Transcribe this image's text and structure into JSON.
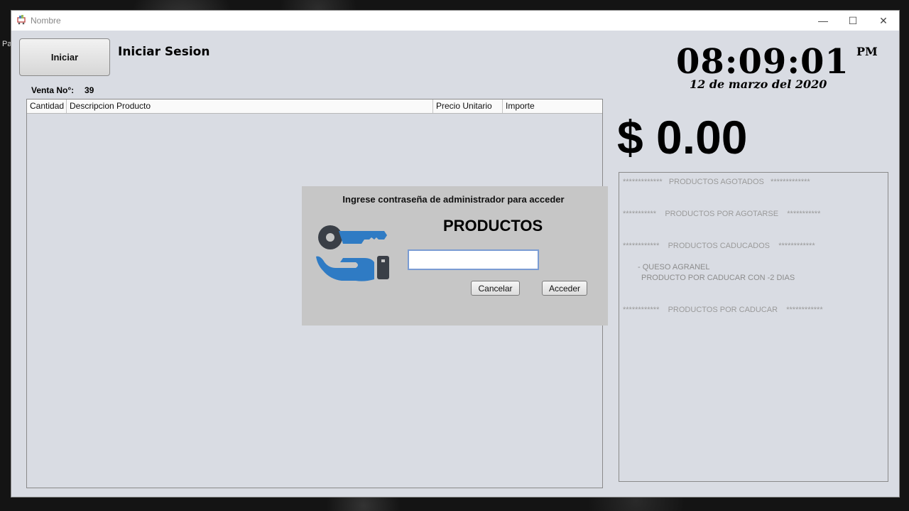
{
  "window": {
    "title": "Nombre",
    "minimize": "—",
    "maximize": "☐",
    "close": "✕"
  },
  "desktop": {
    "partial_label": "Pa"
  },
  "header": {
    "start_button": "Iniciar",
    "session_label": "Iniciar Sesion"
  },
  "sale": {
    "label": "Venta No°:",
    "number": "39"
  },
  "table": {
    "columns": [
      "Cantidad",
      "Descripcion Producto",
      "Precio Unitario",
      "Importe"
    ],
    "rows": []
  },
  "clock": {
    "time": "08:09:01",
    "ampm": "PM",
    "date": "12 de marzo del 2020"
  },
  "total": "$ 0.00",
  "alerts": {
    "agotados": "*************   PRODUCTOS AGOTADOS   *************",
    "por_agotarse": "***********    PRODUCTOS POR AGOTARSE    ***********",
    "caducados": "************    PRODUCTOS CADUCADOS    ************",
    "caducados_item_1": "- QUESO AGRANEL",
    "caducados_item_2": "PRODUCTO POR CADUCAR CON -2 DIAS",
    "por_caducar": "************    PRODUCTOS POR CADUCAR    ************"
  },
  "dialog": {
    "message": "Ingrese contraseña de administrador para acceder",
    "title": "PRODUCTOS",
    "password_value": "",
    "cancel": "Cancelar",
    "accept": "Acceder",
    "icon": "key-hand-icon"
  },
  "colors": {
    "window_bg": "#d9dce3",
    "dialog_bg": "#c6c6c6",
    "icon_blue": "#2f7bc4",
    "icon_dark": "#3a3f47"
  }
}
